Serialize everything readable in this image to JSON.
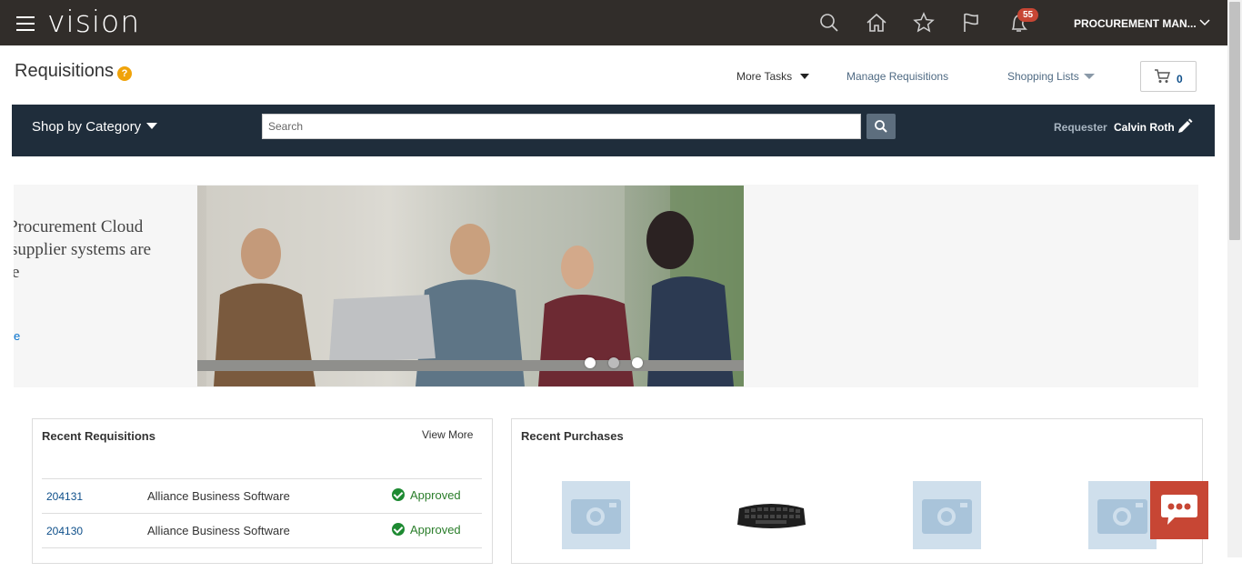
{
  "topbar": {
    "logo": "vision",
    "notification_count": "55",
    "user": "PROCUREMENT MAN...",
    "icons": [
      "menu-icon",
      "search-icon",
      "home-icon",
      "star-icon",
      "flag-icon",
      "bell-icon",
      "chevron-down-icon"
    ]
  },
  "page": {
    "title": "Requisitions",
    "help": "?",
    "more_tasks": "More Tasks",
    "manage_requisitions": "Manage Requisitions",
    "shopping_lists": "Shopping Lists",
    "cart_count": "0"
  },
  "nav": {
    "shop_by_category": "Shop by Category",
    "search_placeholder": "Search",
    "requester_label": "Requester",
    "requester_name": "Calvin Roth"
  },
  "banner": {
    "line1": "Procurement Cloud",
    "line2": "supplier systems are",
    "line3": "e",
    "link": "e"
  },
  "recent_requisitions": {
    "title": "Recent Requisitions",
    "view_more": "View More",
    "rows": [
      {
        "id": "204131",
        "supplier": "Alliance Business Software",
        "status": "Approved"
      },
      {
        "id": "204130",
        "supplier": "Alliance Business Software",
        "status": "Approved"
      }
    ]
  },
  "recent_purchases": {
    "title": "Recent Purchases",
    "items": [
      "camera-placeholder-icon",
      "keyboard-image",
      "camera-placeholder-icon",
      "camera-placeholder-icon"
    ]
  },
  "colors": {
    "topbar": "#312d2a",
    "nav_band": "#1f2d3b",
    "accent_red": "#c74634",
    "approved_green": "#1e8a32"
  }
}
